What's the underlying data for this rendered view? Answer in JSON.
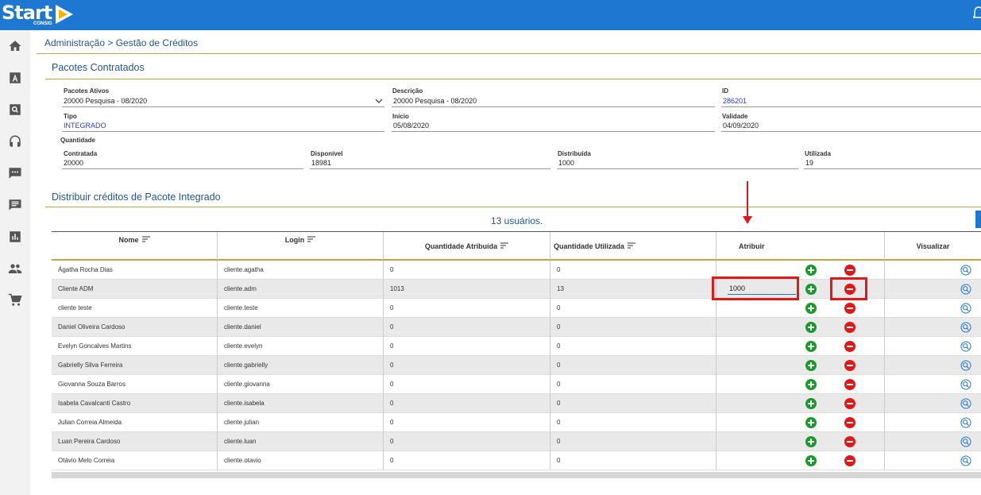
{
  "app": {
    "logo_text": "Start",
    "logo_sub": "CONSIG"
  },
  "breadcrumb": "Administração > Gestão de Créditos",
  "section_pacotes": "Pacotes Contratados",
  "fields": {
    "pacotes_ativos_label": "Pacotes Ativos",
    "pacotes_ativos_value": "20000 Pesquisa - 08/2020",
    "descricao_label": "Descrição",
    "descricao_value": "20000 Pesquisa - 08/2020",
    "id_label": "ID",
    "id_value": "286201",
    "tipo_label": "Tipo",
    "tipo_value": "INTEGRADO",
    "inicio_label": "Início",
    "inicio_value": "05/08/2020",
    "validade_label": "Validade",
    "validade_value": "04/09/2020",
    "quantidade_label": "Quantidade",
    "contratada_label": "Contratada",
    "contratada_value": "20000",
    "disponivel_label": "Disponível",
    "disponivel_value": "18981",
    "distribuida_label": "Distribuída",
    "distribuida_value": "1000",
    "utilizada_label": "Utilizada",
    "utilizada_value": "19"
  },
  "section_distribuir": "Distribuir créditos de Pacote Integrado",
  "users_count": "13 usuários.",
  "table": {
    "headers": {
      "nome": "Nome",
      "login": "Login",
      "qtd_atribuida": "Quantidade Atribuída",
      "qtd_utilizada": "Quantidade Utilizada",
      "atribuir": "Atribuir",
      "visualizar": "Visualizar"
    },
    "rows": [
      {
        "nome": "Ágatha Rocha Dias",
        "login": "cliente.agatha",
        "atribuida": "0",
        "utilizada": "0"
      },
      {
        "nome": "Cliente ADM",
        "login": "cliente.adm",
        "atribuida": "1013",
        "utilizada": "13",
        "atribuir": "1000"
      },
      {
        "nome": "cliente teste",
        "login": "cliente.teste",
        "atribuida": "0",
        "utilizada": "0"
      },
      {
        "nome": "Daniel Oliveira Cardoso",
        "login": "cliente.daniel",
        "atribuida": "0",
        "utilizada": "0"
      },
      {
        "nome": "Evelyn Goncalves Martins",
        "login": "cliente.evelyn",
        "atribuida": "0",
        "utilizada": "0"
      },
      {
        "nome": "Gabrielly Silva Ferreira",
        "login": "cliente.gabrielly",
        "atribuida": "0",
        "utilizada": "0"
      },
      {
        "nome": "Giovanna Souza Barros",
        "login": "cliente.giovanna",
        "atribuida": "0",
        "utilizada": "0"
      },
      {
        "nome": "Isabela Cavalcanti Castro",
        "login": "cliente.isabela",
        "atribuida": "0",
        "utilizada": "0"
      },
      {
        "nome": "Julian Correia Almeida",
        "login": "cliente.julian",
        "atribuida": "0",
        "utilizada": "0"
      },
      {
        "nome": "Luan Pereira Cardoso",
        "login": "cliente.luan",
        "atribuida": "0",
        "utilizada": "0"
      },
      {
        "nome": "Otávio Melo Correia",
        "login": "cliente.otavio",
        "atribuida": "0",
        "utilizada": "0"
      }
    ]
  },
  "sidebar": {
    "items": [
      {
        "icon": "home-icon"
      },
      {
        "icon": "font-icon"
      },
      {
        "icon": "search-box-icon"
      },
      {
        "icon": "headset-icon"
      },
      {
        "icon": "chat-dots-icon"
      },
      {
        "icon": "message-icon"
      },
      {
        "icon": "bar-chart-icon"
      },
      {
        "icon": "people-icon"
      },
      {
        "icon": "cart-icon"
      }
    ]
  },
  "colors": {
    "brand": "#1e78d2",
    "accent_rule": "#bfa54a",
    "add": "#1a9a2e",
    "remove": "#e01818",
    "highlight": "#e01818"
  }
}
